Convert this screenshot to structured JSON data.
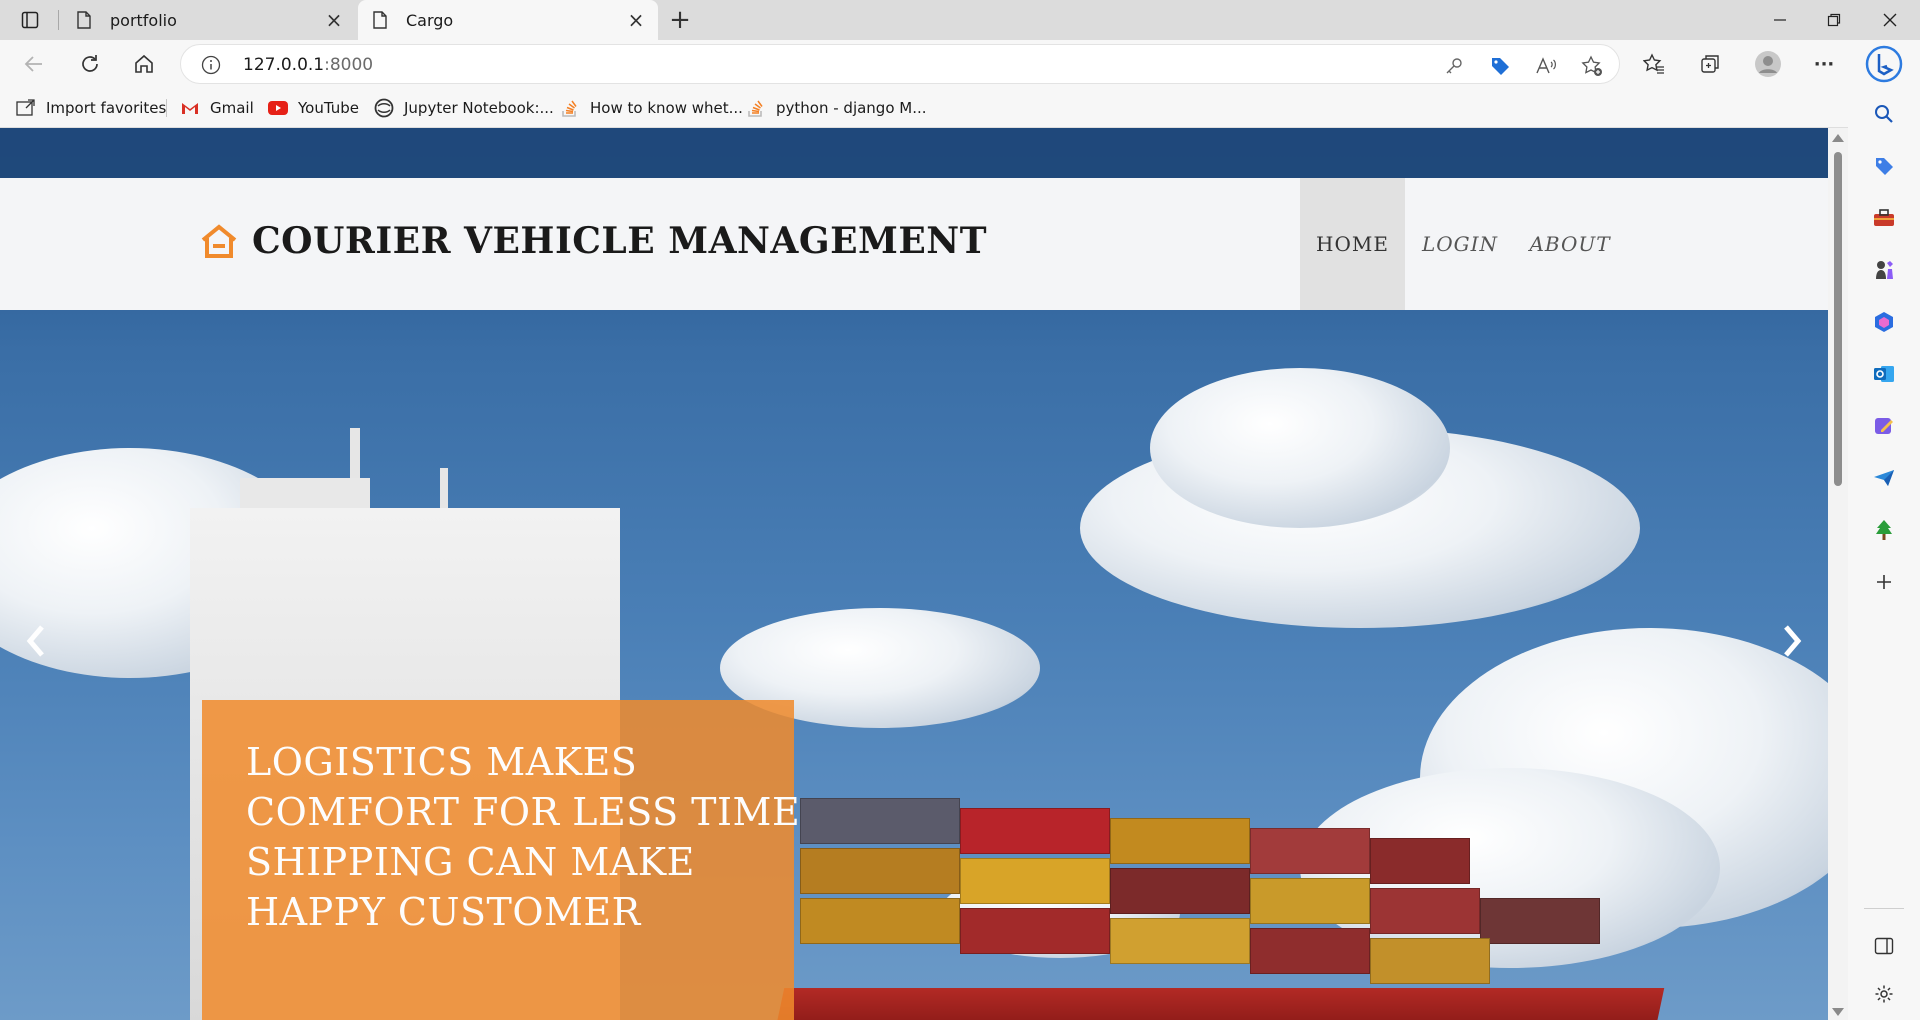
{
  "browser": {
    "tabs": [
      {
        "title": "portfolio",
        "active": false
      },
      {
        "title": "Cargo",
        "active": true
      }
    ],
    "close_glyph": "×",
    "new_tab_glyph": "+",
    "address": {
      "url": "127.0.0.1",
      "port": ":8000"
    },
    "favorites": [
      {
        "label": "Import favorites",
        "icon": "import-icon"
      },
      {
        "label": "Gmail",
        "icon": "gmail-icon"
      },
      {
        "label": "YouTube",
        "icon": "youtube-icon"
      },
      {
        "label": "Jupyter Notebook:...",
        "icon": "jupyter-icon"
      },
      {
        "label": "How to know whet...",
        "icon": "stackoverflow-icon"
      },
      {
        "label": "python - django M...",
        "icon": "stackoverflow-icon"
      }
    ],
    "more_glyph": "···"
  },
  "site": {
    "brand_title": "COURIER VEHICLE MANAGEMENT",
    "nav": [
      {
        "label": "HOME",
        "active": true
      },
      {
        "label": "LOGIN",
        "active": false
      },
      {
        "label": "ABOUT",
        "active": false
      }
    ],
    "caption_lines": [
      "LOGISTICS MAKES",
      "COMFORT FOR LESS TIME",
      "SHIPPING CAN MAKE",
      "HAPPY CUSTOMER"
    ]
  },
  "colors": {
    "accent_orange": "#f08a2c",
    "header_bg": "#f4f5f7",
    "nav_active_bg": "#e1e1e1"
  }
}
